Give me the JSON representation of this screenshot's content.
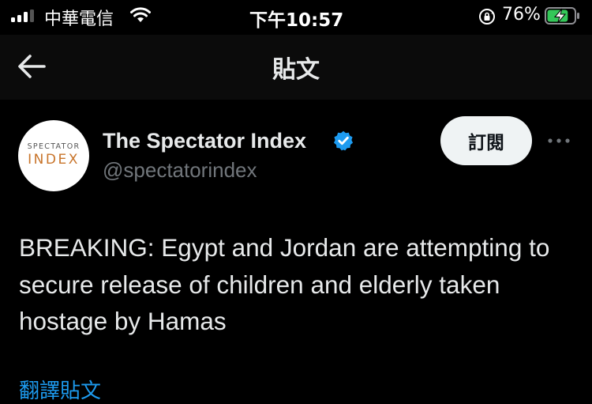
{
  "status_bar": {
    "carrier": "中華電信",
    "time": "下午10:57",
    "battery_percent": "76%",
    "battery_level": 0.76,
    "icons": [
      "signal-icon",
      "wifi-icon",
      "rotation-lock-icon",
      "battery-charging-icon"
    ]
  },
  "nav": {
    "title": "貼文",
    "back_icon": "arrow-left-icon"
  },
  "tweet": {
    "avatar": {
      "line1": "SPECTATOR",
      "line2": "INDEX"
    },
    "display_name": "The Spectator Index",
    "verified_icon": "verified-badge-icon",
    "handle": "@spectatorindex",
    "subscribe_label": "訂閱",
    "more_icon": "more-horizontal-icon",
    "text": "BREAKING: Egypt and Jordan are attempting to secure release of children and elderly taken hostage by Hamas",
    "translate_label": "翻譯貼文"
  },
  "colors": {
    "background": "#000000",
    "accent": "#1d9bf0",
    "text_primary": "#e7e9ea",
    "text_secondary": "#71767b",
    "battery_green": "#34c759",
    "avatar_index_orange": "#c8742a"
  }
}
